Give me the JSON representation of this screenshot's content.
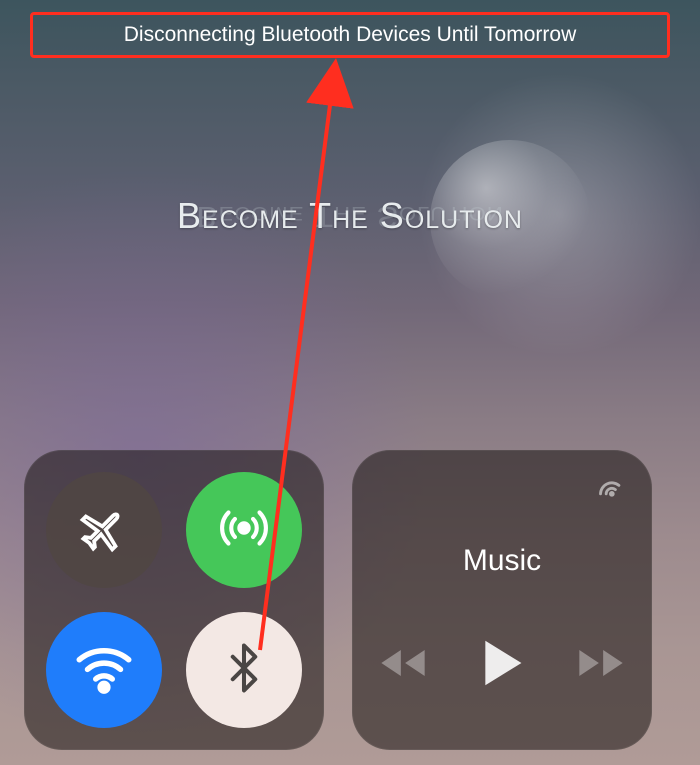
{
  "banner": {
    "text": "Disconnecting Bluetooth Devices Until Tomorrow"
  },
  "watermark": {
    "text": "Become The Solution"
  },
  "connectivity": {
    "airplane": {
      "label": "airplane-mode",
      "active": false
    },
    "cellular": {
      "label": "cellular-data",
      "active": true
    },
    "wifi": {
      "label": "wifi",
      "active": true
    },
    "bluetooth": {
      "label": "bluetooth",
      "active": false
    }
  },
  "music": {
    "title": "Music",
    "controls": {
      "rewind": "rewind",
      "play": "play",
      "forward": "forward"
    }
  },
  "colors": {
    "highlight": "#ff2e1f",
    "green": "#45c759",
    "blue": "#1f7dfb"
  }
}
